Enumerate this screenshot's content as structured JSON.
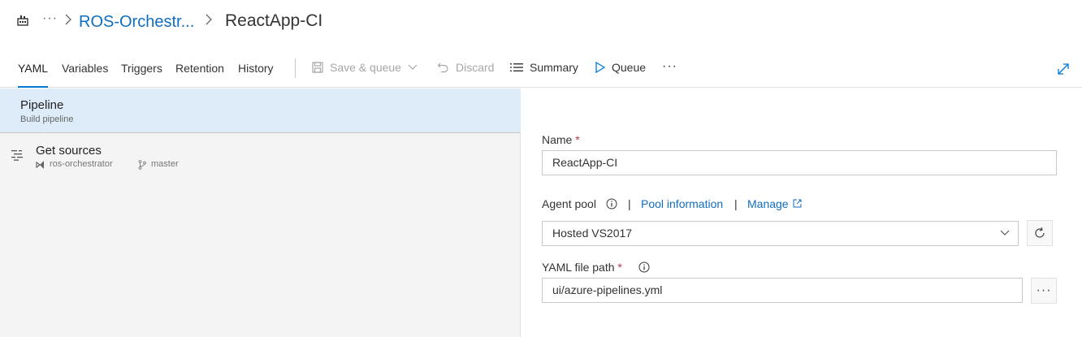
{
  "breadcrumb": {
    "app_icon": "build-pipeline-icon",
    "more": "···",
    "parent": "ROS-Orchestr...",
    "current": "ReactApp-CI"
  },
  "tabs": [
    {
      "label": "YAML",
      "active": true
    },
    {
      "label": "Variables",
      "active": false
    },
    {
      "label": "Triggers",
      "active": false
    },
    {
      "label": "Retention",
      "active": false
    },
    {
      "label": "History",
      "active": false
    }
  ],
  "toolbar": {
    "save_queue": "Save & queue",
    "discard": "Discard",
    "summary": "Summary",
    "queue": "Queue",
    "more": "···"
  },
  "left_panel": {
    "pipeline_title": "Pipeline",
    "pipeline_subtitle": "Build pipeline",
    "sources_title": "Get sources",
    "repo": "ros-orchestrator",
    "branch": "master"
  },
  "form": {
    "name_label": "Name",
    "name_value": "ReactApp-CI",
    "required_mark": "*",
    "agent_pool_label": "Agent pool",
    "pool_information": "Pool information",
    "manage": "Manage",
    "separator": "|",
    "agent_pool_value": "Hosted VS2017",
    "yaml_path_label": "YAML file path",
    "yaml_path_value": "ui/azure-pipelines.yml",
    "browse": "···"
  },
  "colors": {
    "accent": "#0078d4",
    "link": "#106ebe",
    "selected_bg": "#deecf9",
    "panel_bg": "#f4f4f4",
    "required": "#c4314b"
  }
}
